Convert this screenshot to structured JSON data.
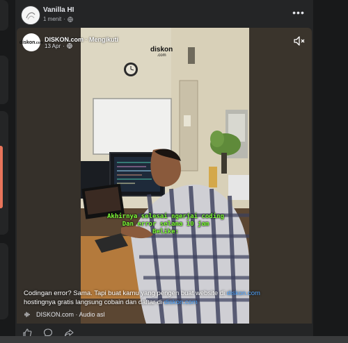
{
  "post": {
    "author": "Vanilla HI",
    "time": "1 menit",
    "separator": "·"
  },
  "reel": {
    "page_name": "DISKON.com · Mengikuti",
    "date": "13 Apr",
    "separator": "·",
    "logo_text": "diskon",
    "logo_sub": ".com",
    "watermark": "diskon",
    "watermark_sub": ".com",
    "caption_lines": [
      "Akhirnya selesai ngerjai coding",
      "Dan error selama 10 jam",
      "Belike:"
    ],
    "description_prefix": "Codingan error? Sama. Tapi buat kamu yang pengen buat website di ",
    "link1": "diskon.com",
    "description_middle": "hostingnya gratis langsung cobain dan daftar di ",
    "link2": "diskon.com",
    "audio_text": "DISKON.com · Audio asl"
  },
  "colors": {
    "background": "#18191a",
    "card": "#242526",
    "link": "#4da3ff",
    "caption": "#7fff3a"
  },
  "icons": [
    "globe-icon",
    "more-icon",
    "mute-icon",
    "audio-wave-icon",
    "like-icon",
    "comment-icon",
    "share-icon"
  ]
}
